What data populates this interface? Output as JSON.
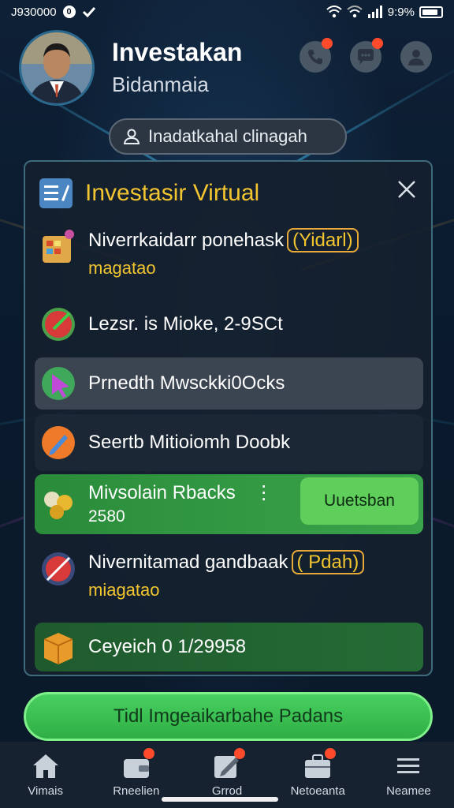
{
  "status_bar": {
    "time": "J930000",
    "app_badge": "0",
    "battery": "9:9%"
  },
  "header": {
    "title": "Investakan",
    "subtitle": "Bidanmaia"
  },
  "search": {
    "label": "Inadatkahal clinagah"
  },
  "panel": {
    "title": "Investasir Virtual",
    "rows": [
      {
        "main": "Niverrkaidarr ponehask",
        "tag": "(Yidarl)",
        "sub": "magatao"
      },
      {
        "main": "Lezsr. is Mioke, 2-9SCt"
      },
      {
        "main": "Prnedth Mwsckki0Ocks"
      },
      {
        "main": "Seertb Mitioiomh Doobk"
      },
      {
        "main": "Mivsolain Rbacks",
        "sub": "2580",
        "button": "Uuetsban",
        "more": "⋮"
      },
      {
        "main": "Nivernitamad gandbaak",
        "tag": "( Pdah)",
        "sub": "miagatao"
      },
      {
        "main": "Ceyeich 0 1/29958"
      }
    ]
  },
  "main_action": {
    "label": "Tidl Imgeaikarbahe Padans"
  },
  "bottom_nav": [
    {
      "label": "Vimais",
      "icon": "home-icon"
    },
    {
      "label": "Rneelien",
      "icon": "wallet-icon"
    },
    {
      "label": "Grrod",
      "icon": "edit-icon"
    },
    {
      "label": "Netoeanta",
      "icon": "briefcase-icon"
    },
    {
      "label": "Neamee",
      "icon": "menu-icon"
    }
  ],
  "colors": {
    "accent_yellow": "#f2c530",
    "accent_green": "#3aa44a",
    "badge_red": "#ff4b2b"
  }
}
